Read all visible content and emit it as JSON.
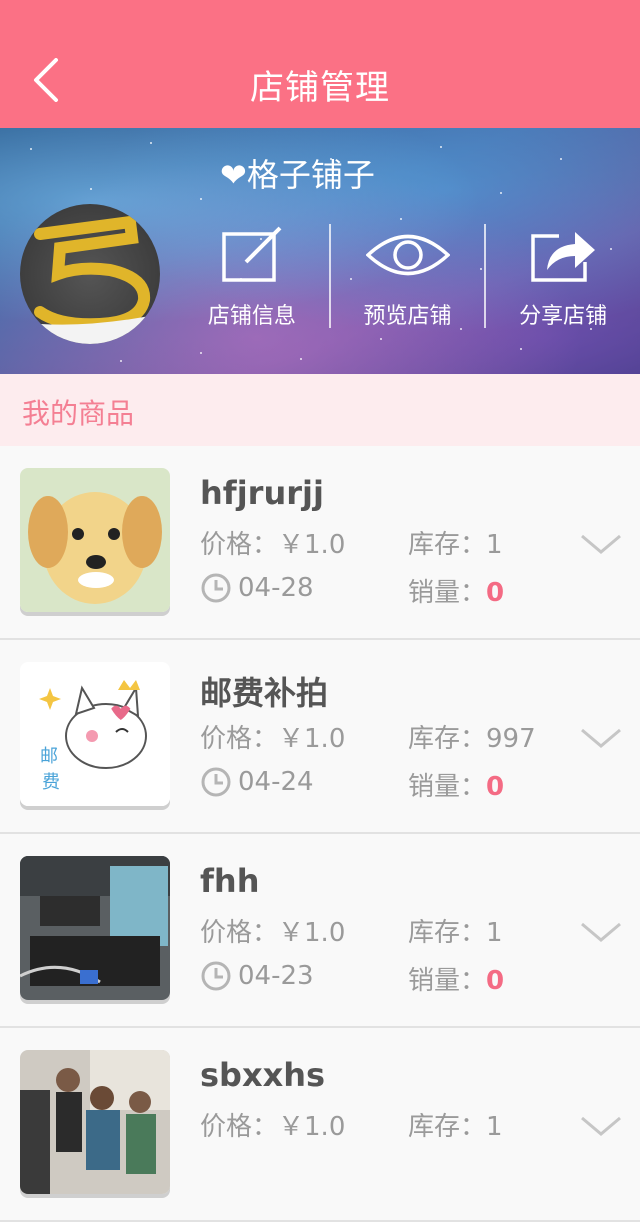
{
  "header": {
    "title": "店铺管理"
  },
  "shop": {
    "name": "❤格子铺子",
    "actions": [
      {
        "label": "店铺信息",
        "icon": "edit-icon"
      },
      {
        "label": "预览店铺",
        "icon": "eye-icon"
      },
      {
        "label": "分享店铺",
        "icon": "share-icon"
      }
    ]
  },
  "section": {
    "title": "我的商品"
  },
  "products": [
    {
      "name": "hfjrurjj",
      "price_label": "价格：",
      "price": "￥1.0",
      "stock_label": "库存：",
      "stock": "1",
      "date": "04-28",
      "sales_label": "销量：",
      "sales": "0"
    },
    {
      "name": "邮费补拍",
      "price_label": "价格：",
      "price": "￥1.0",
      "stock_label": "库存：",
      "stock": "997",
      "date": "04-24",
      "sales_label": "销量：",
      "sales": "0"
    },
    {
      "name": "fhh",
      "price_label": "价格：",
      "price": "￥1.0",
      "stock_label": "库存：",
      "stock": "1",
      "date": "04-23",
      "sales_label": "销量：",
      "sales": "0"
    },
    {
      "name": "sbxxhs",
      "price_label": "价格：",
      "price": "￥1.0",
      "stock_label": "库存：",
      "stock": "1",
      "date": "",
      "sales_label": "",
      "sales": ""
    }
  ],
  "colors": {
    "accent": "#fb7185",
    "sales": "#f46b84",
    "section_text": "#f47f93"
  }
}
